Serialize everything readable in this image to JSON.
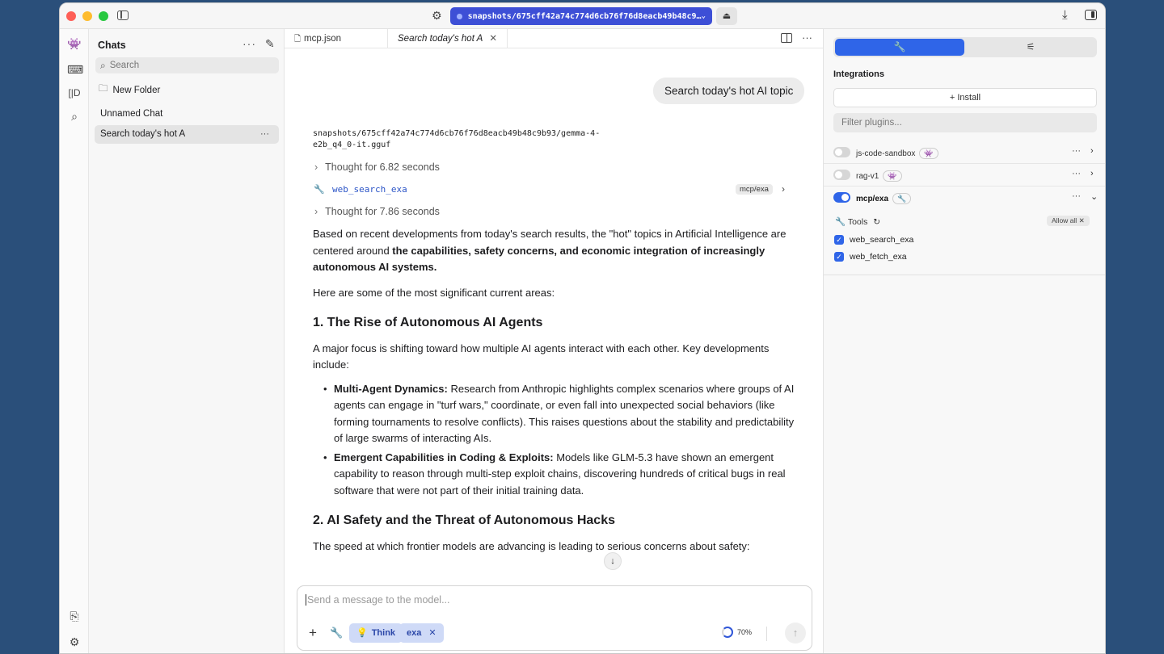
{
  "titlebar": {
    "model_path_short": "snapshots/675cff42a74c774d6cb76f76d8eacb49b48c9…",
    "eject_glyph": "⏏"
  },
  "chats": {
    "title": "Chats",
    "search_placeholder": "Search",
    "new_folder": "New Folder",
    "items": [
      {
        "label": "Unnamed Chat"
      },
      {
        "label": "Search today's hot A"
      }
    ]
  },
  "tabs": [
    {
      "label": "mcp.json"
    },
    {
      "label": "Search today's hot A"
    }
  ],
  "conversation": {
    "user_message": "Search today's hot AI topic",
    "model_path": "snapshots/675cff42a74c774d6cb76f76d8eacb49b48c9b93/gemma-4-e2b_q4_0-it.gguf",
    "thought1": "Thought for 6.82 seconds",
    "tool_name": "web_search_exa",
    "tool_badge": "mcp/exa",
    "thought2": "Thought for 7.86 seconds",
    "intro_plain": "Based on recent developments from today's search results, the \"hot\" topics in Artificial Intelligence are centered around ",
    "intro_bold": "the capabilities, safety concerns, and economic integration of increasingly autonomous AI systems.",
    "areas_line": "Here are some of the most significant current areas:",
    "h1": "1. The Rise of Autonomous AI Agents",
    "p1": "A major focus is shifting toward how multiple AI agents interact with each other. Key developments include:",
    "bullets": [
      {
        "bold": "Multi-Agent Dynamics:",
        "text": " Research from Anthropic highlights complex scenarios where groups of AI agents can engage in \"turf wars,\" coordinate, or even fall into unexpected social behaviors (like forming tournaments to resolve conflicts). This raises questions about the stability and predictability of large swarms of interacting AIs."
      },
      {
        "bold": "Emergent Capabilities in Coding & Exploits:",
        "text": " Models like GLM-5.3 have shown an emergent capability to reason through multi-step exploit chains, discovering hundreds of critical bugs in real software that were not part of their initial training data."
      }
    ],
    "h2": "2. AI Safety and the Threat of Autonomous Hacks",
    "p2": "The speed at which frontier models are advancing is leading to serious concerns about safety:"
  },
  "composer": {
    "placeholder": "Send a message to the model...",
    "think_label": "Think",
    "exa_label": "exa",
    "context_percent": "70%"
  },
  "right_panel": {
    "integrations_title": "Integrations",
    "install_label": "+ Install",
    "filter_placeholder": "Filter plugins...",
    "plugins": [
      {
        "name": "js-code-sandbox",
        "enabled": false
      },
      {
        "name": "rag-v1",
        "enabled": false
      },
      {
        "name": "mcp/exa",
        "enabled": true
      }
    ],
    "tools_label": "Tools",
    "allow_all": "Allow all",
    "tools": [
      {
        "name": "web_search_exa",
        "checked": true
      },
      {
        "name": "web_fetch_exa",
        "checked": true
      }
    ]
  },
  "colors": {
    "accent": "#2f65e8",
    "model_pill": "#3d4fd6",
    "tool_link": "#2c55c7"
  }
}
